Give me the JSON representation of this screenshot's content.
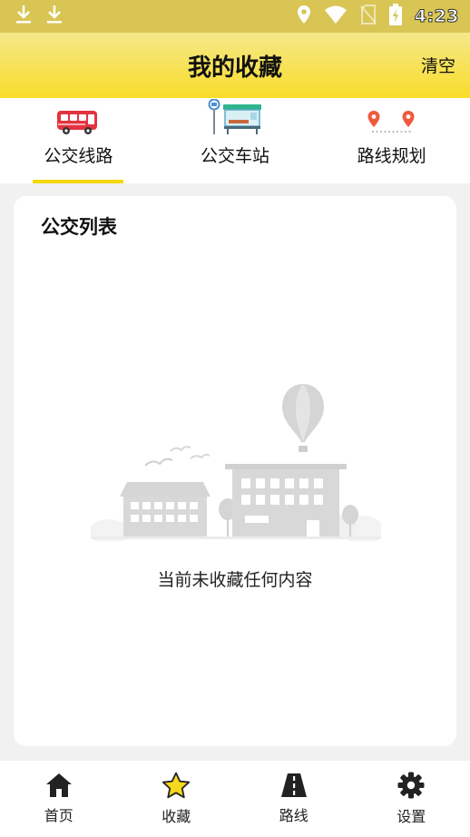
{
  "status_bar": {
    "time": "4:23",
    "icons": [
      "download-icon",
      "download-icon",
      "location-icon",
      "wifi-icon",
      "no-sim-icon",
      "battery-charging-icon"
    ]
  },
  "header": {
    "title": "我的收藏",
    "clear_label": "清空"
  },
  "tabs": [
    {
      "label": "公交线路",
      "icon": "bus-icon",
      "active": true
    },
    {
      "label": "公交车站",
      "icon": "bus-stop-icon",
      "active": false
    },
    {
      "label": "路线规划",
      "icon": "route-pins-icon",
      "active": false
    }
  ],
  "card": {
    "title": "公交列表",
    "empty_message": "当前未收藏任何内容"
  },
  "bottom_nav": [
    {
      "label": "首页",
      "icon": "home-icon"
    },
    {
      "label": "收藏",
      "icon": "star-icon",
      "active": true
    },
    {
      "label": "路线",
      "icon": "road-icon"
    },
    {
      "label": "设置",
      "icon": "gear-icon"
    }
  ],
  "colors": {
    "accent": "#f4d800",
    "status_bar": "#d8c554",
    "header_top": "#f5e88a",
    "header_bottom": "#f9dc2a",
    "bus_red": "#e2343f",
    "pin_red": "#f05a3c",
    "star_yellow": "#f6d81c",
    "illustration_gray": "#d5d5d5"
  }
}
